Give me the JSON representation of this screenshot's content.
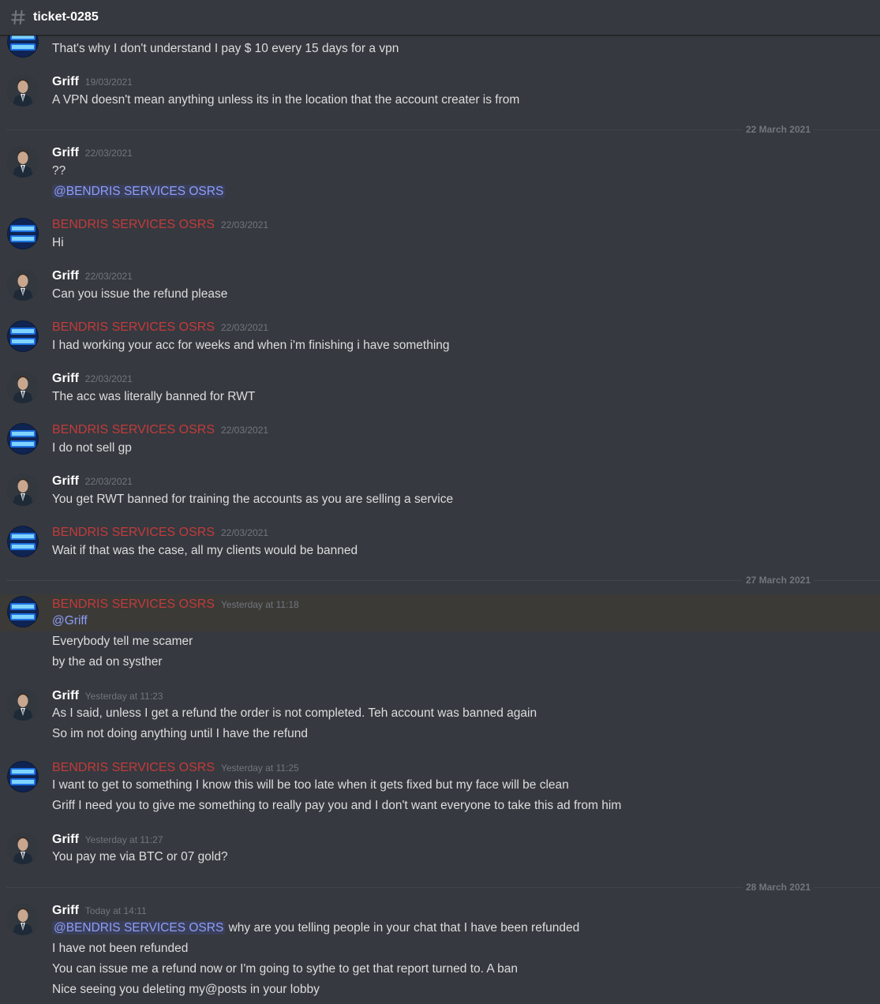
{
  "channel": {
    "name": "ticket-0285"
  },
  "dividers": {
    "d1": "22 March 2021",
    "d2": "27 March 2021",
    "d3": "28 March 2021"
  },
  "msgs": {
    "m0": {
      "lines": [
        "That's why I don't understand I pay $ 10 every 15 days for a vpn"
      ]
    },
    "m1": {
      "author": "Griff",
      "ts": "19/03/2021",
      "lines": [
        "A VPN doesn't mean anything unless its in the location that the account creater is from"
      ]
    },
    "m2": {
      "author": "Griff",
      "ts": "22/03/2021",
      "lines": [
        "??",
        "@BENDRIS SERVICES OSRS"
      ]
    },
    "m3": {
      "author": "BENDRIS SERVICES OSRS",
      "ts": "22/03/2021",
      "lines": [
        "Hi"
      ]
    },
    "m4": {
      "author": "Griff",
      "ts": "22/03/2021",
      "lines": [
        "Can you issue the refund please"
      ]
    },
    "m5": {
      "author": "BENDRIS SERVICES OSRS",
      "ts": "22/03/2021",
      "lines": [
        "I had working your acc for weeks and when i'm finishing i have something"
      ]
    },
    "m6": {
      "author": "Griff",
      "ts": "22/03/2021",
      "lines": [
        "The acc was literally banned for RWT"
      ]
    },
    "m7": {
      "author": "BENDRIS SERVICES OSRS",
      "ts": "22/03/2021",
      "lines": [
        "I do not sell gp"
      ]
    },
    "m8": {
      "author": "Griff",
      "ts": "22/03/2021",
      "lines": [
        "You get RWT banned for training the accounts as you are selling a service"
      ]
    },
    "m9": {
      "author": "BENDRIS SERVICES OSRS",
      "ts": "22/03/2021",
      "lines": [
        "Wait if that was the case, all my clients would be banned"
      ]
    },
    "m10": {
      "author": "BENDRIS SERVICES OSRS",
      "ts": "Yesterday at 11:18",
      "lines": [
        "@Griff",
        "Everybody tell me scamer",
        "by the ad on systher"
      ]
    },
    "m11": {
      "author": "Griff",
      "ts": "Yesterday at 11:23",
      "lines": [
        "As I said, unless I get a refund the order is not completed. Teh account was banned again",
        "So im not doing anything until I have the refund"
      ]
    },
    "m12": {
      "author": "BENDRIS SERVICES OSRS",
      "ts": "Yesterday at 11:25",
      "lines": [
        "I want to get to something I know this will be too late when it gets fixed but my face will be clean",
        "Griff I need you to give me something to really pay you and I don't want everyone to take this ad from him"
      ]
    },
    "m13": {
      "author": "Griff",
      "ts": "Yesterday at 11:27",
      "lines": [
        "You pay me via BTC or 07 gold?"
      ]
    },
    "m14": {
      "author": "Griff",
      "ts": "Today at 14:11",
      "mention": "@BENDRIS SERVICES OSRS",
      "lines": [
        " why are you telling people in your chat that I have been refunded",
        "I have not been refunded",
        "You can issue me a refund now or I'm going to sythe to get that report turned to. A ban",
        "Nice seeing you deleting my@posts in your lobby"
      ]
    }
  },
  "colors": {
    "bg": "#36393f",
    "bot_name": "#c33b3b",
    "mention": "#8e9efa",
    "highlight": "#3b3a37"
  },
  "icons": {
    "channel": "hash-icon",
    "griff_avatar": "griff-avatar",
    "bot_avatar": "bendris-avatar"
  }
}
